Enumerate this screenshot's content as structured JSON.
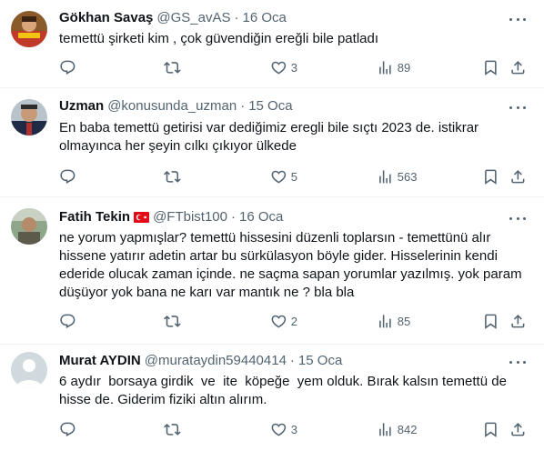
{
  "tweets": [
    {
      "name": "Gökhan Savaş",
      "handle": "@GS_avAS",
      "time": "16 Oca",
      "text": "temettü şirketi kim , çok güvendiğin ereğli bile patladı",
      "likes": "3",
      "views": "89",
      "flag": false,
      "avatar": "photo"
    },
    {
      "name": "Uzman",
      "handle": "@konusunda_uzman",
      "time": "15 Oca",
      "text": "En baba temettü getirisi var dediğimiz eregli bile sıçtı 2023 de. istikrar olmayınca her şeyin cılkı çıkıyor ülkede",
      "likes": "5",
      "views": "563",
      "flag": false,
      "avatar": "photo"
    },
    {
      "name": "Fatih Tekin",
      "handle": "@FTbist100",
      "time": "16 Oca",
      "text": "ne yorum yapmışlar? temettü hissesini düzenli toplarsın - temettünü alır hissene yatırır adetin artar bu sürkülasyon böyle gider. Hisselerinin kendi ederide olucak zaman içinde. ne saçma sapan yorumlar yazılmış. yok param düşüyor yok bana ne karı var mantık ne ? bla bla",
      "likes": "2",
      "views": "85",
      "flag": true,
      "avatar": "photo"
    },
    {
      "name": "Murat AYDIN",
      "handle": "@murataydin59440414",
      "time": "15 Oca",
      "text": "6 aydır  borsaya girdik  ve  ite  köpeğe  yem olduk. Bırak kalsın temettü de hisse de. Giderim fiziki altın alırım.",
      "likes": "3",
      "views": "842",
      "flag": false,
      "avatar": "default"
    }
  ],
  "icons": {
    "reply": "reply-icon",
    "retweet": "retweet-icon",
    "like": "heart-icon",
    "views": "views-icon",
    "bookmark": "bookmark-icon",
    "share": "share-icon",
    "more": "more-icon"
  },
  "colors": {
    "text": "#0f1419",
    "secondary": "#536471",
    "divider": "#eff3f4"
  }
}
